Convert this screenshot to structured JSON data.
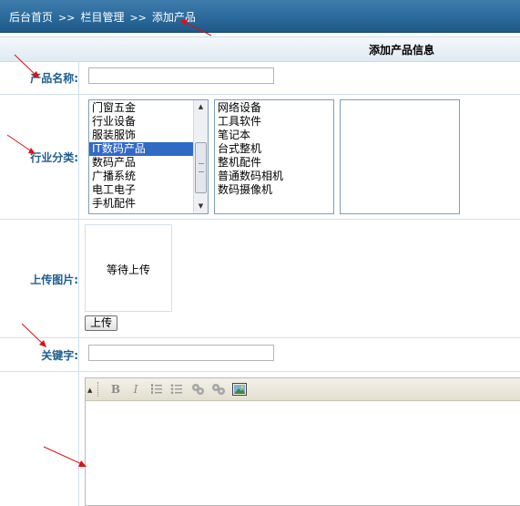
{
  "breadcrumb": {
    "home": "后台首页",
    "sep": ">>",
    "section": "栏目管理",
    "current": "添加产品"
  },
  "form": {
    "title": "添加产品信息",
    "name_label": "产品名称:",
    "category_label": "行业分类:",
    "image_label": "上传图片:",
    "keyword_label": "关键字:",
    "name_value": "",
    "keyword_value": ""
  },
  "categories": {
    "level1": [
      "门窗五金",
      "行业设备",
      "服装服饰",
      "IT数码产品",
      "数码产品",
      "广播系统",
      "电工电子",
      "手机配件"
    ],
    "level1_selected": "IT数码产品",
    "level2": [
      "网络设备",
      "工具软件",
      "笔记本",
      "台式整机",
      "整机配件",
      "普通数码相机",
      "数码摄像机"
    ],
    "level3": []
  },
  "upload": {
    "placeholder": "等待上传",
    "button": "上传"
  },
  "editor": {
    "tools": [
      "collapse-icon",
      "bold-icon",
      "italic-icon",
      "ordered-list-icon",
      "unordered-list-icon",
      "link-icon",
      "unlink-icon",
      "image-icon"
    ]
  },
  "colors": {
    "topbar": "#2a6a9c",
    "label": "#1e5e92",
    "selection": "#316ac5",
    "annotation_arrow": "#dd1111"
  }
}
